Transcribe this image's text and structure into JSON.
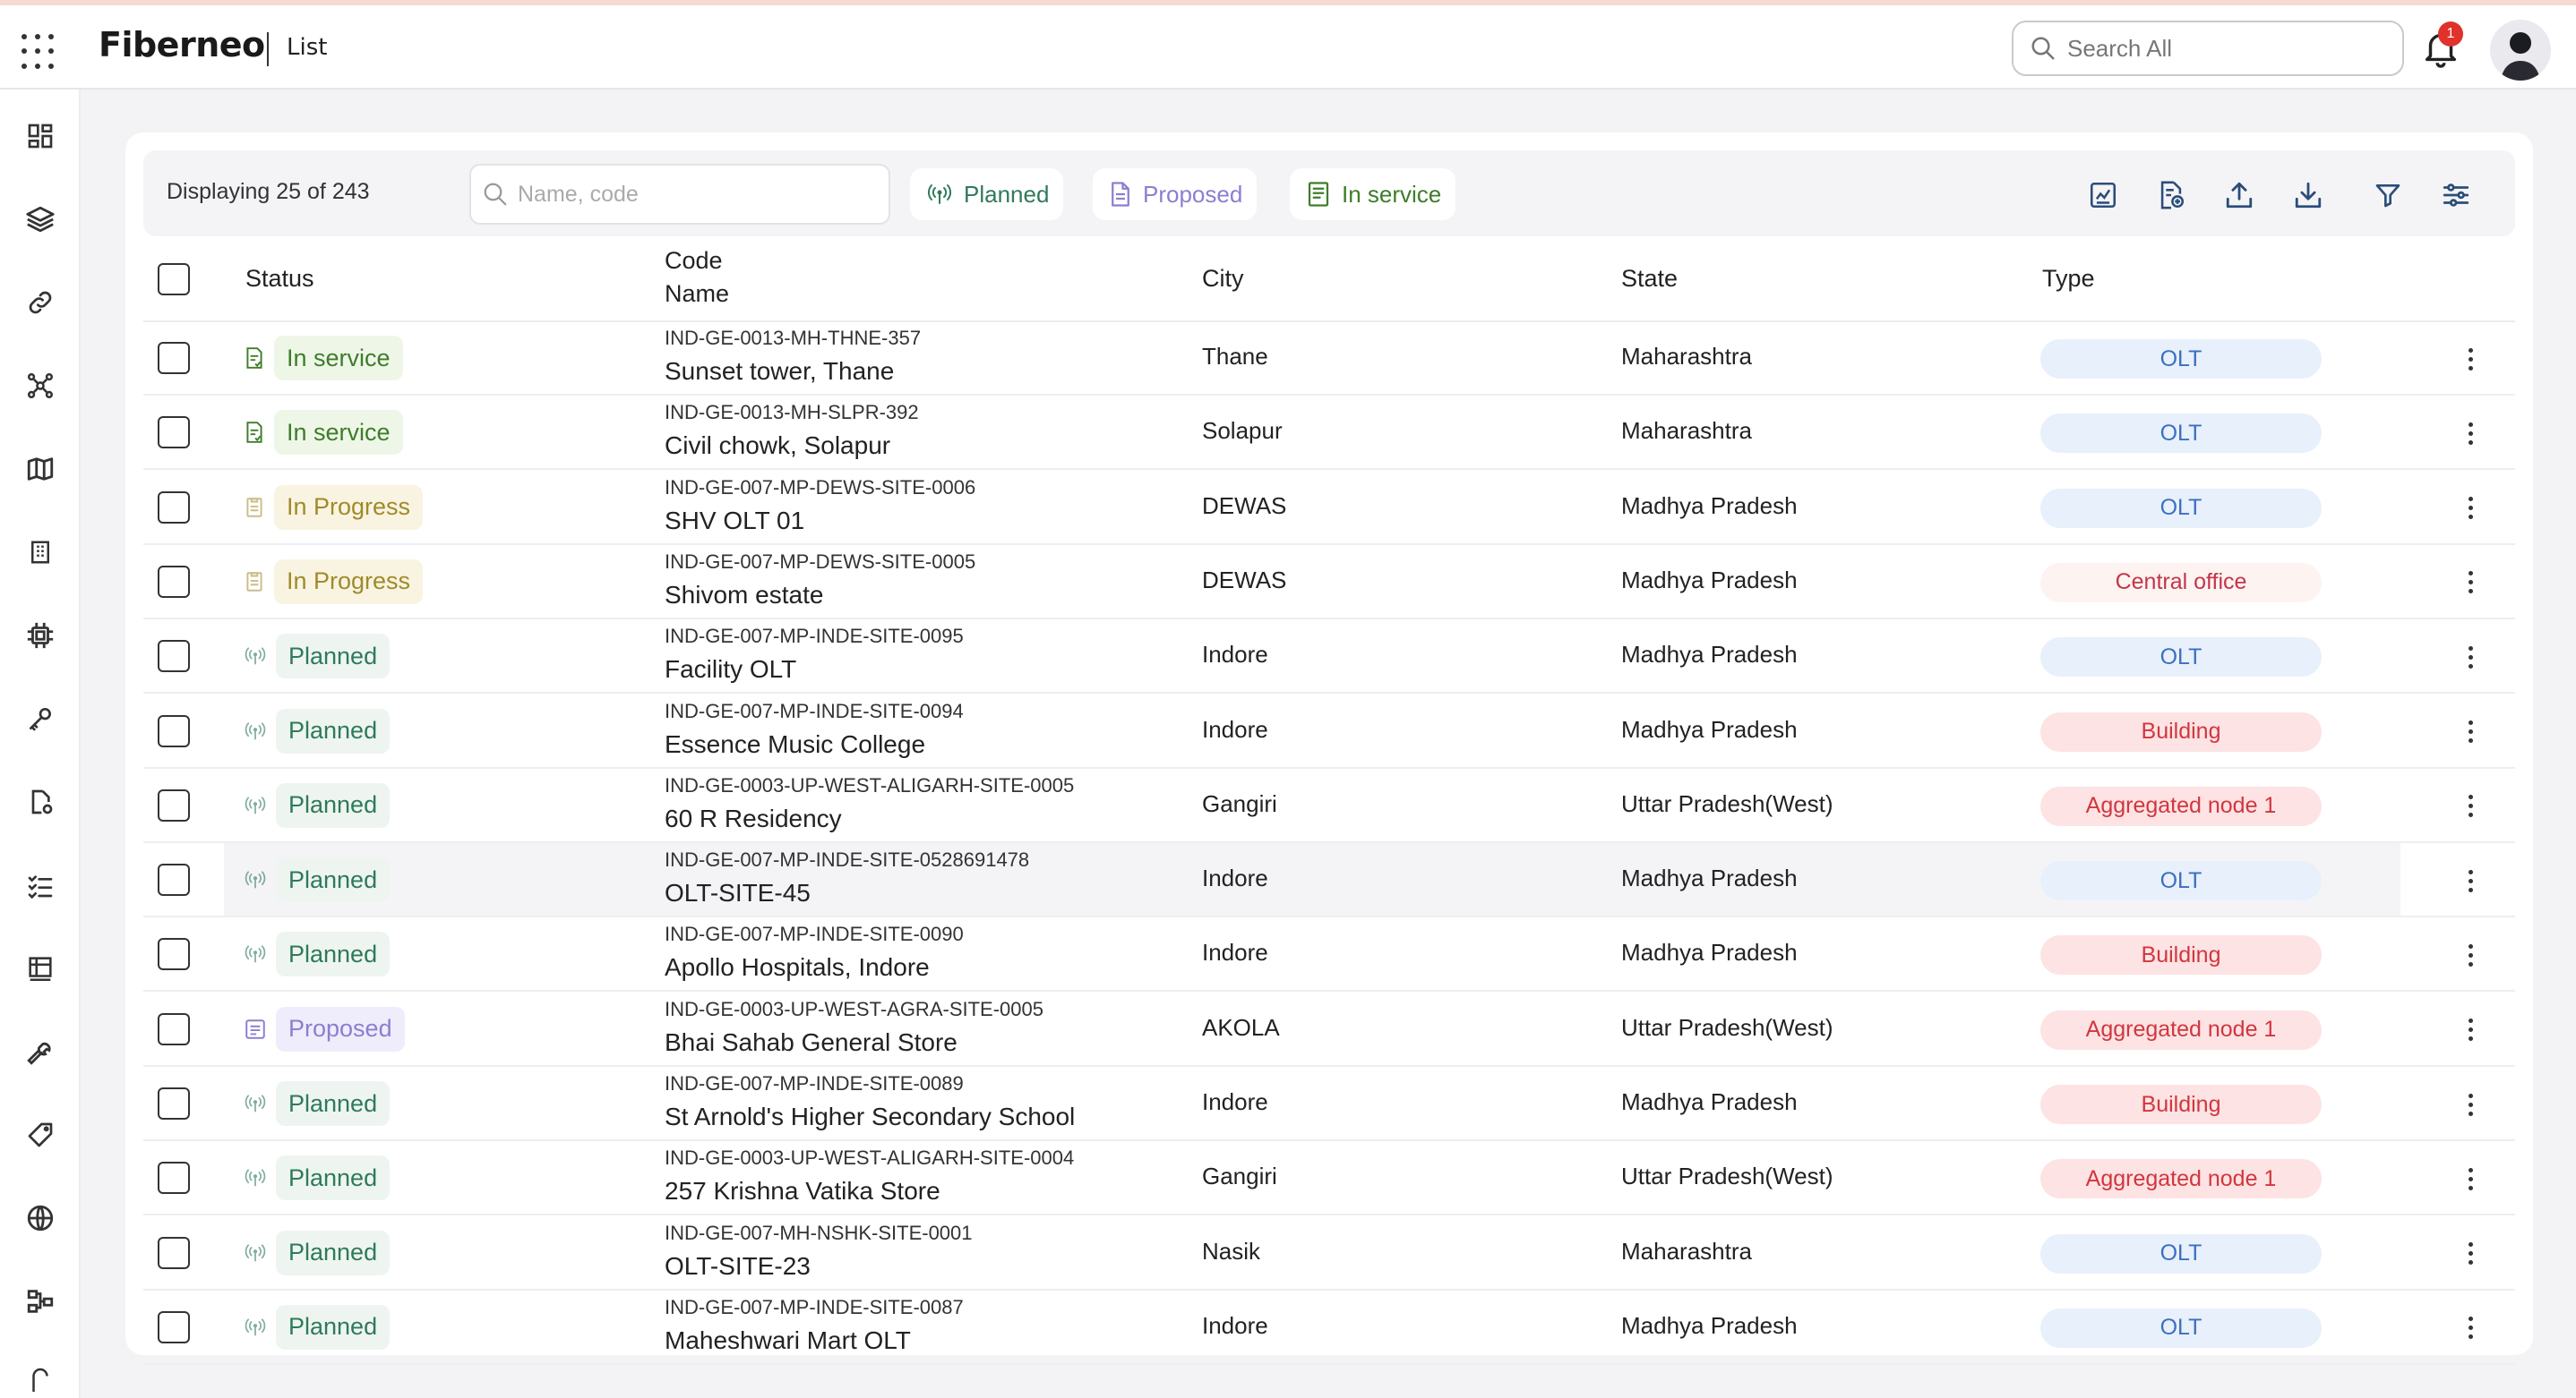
{
  "header": {
    "brand": "Fiberneo",
    "page_name": "List",
    "search_placeholder": "Search All",
    "notification_count": "1"
  },
  "sidebar": {
    "icons": [
      "dashboard-icon",
      "layers-icon",
      "link-icon",
      "network-icon",
      "map-icon",
      "building-icon",
      "chip-icon",
      "wrench-icon",
      "document-settings-icon",
      "checklist-icon",
      "inventory-icon",
      "tools-icon",
      "tag-icon",
      "globe-icon",
      "hierarchy-icon",
      "more-icon"
    ]
  },
  "toolbar": {
    "displaying": "Displaying 25 of 243",
    "search_placeholder": "Name, code",
    "chips": [
      {
        "label": "Planned",
        "color": "#2f7a5a",
        "icon": "antenna-icon"
      },
      {
        "label": "Proposed",
        "color": "#8a7fd0",
        "icon": "document-icon"
      },
      {
        "label": "In service",
        "color": "#3e7d2a",
        "icon": "list-document-icon"
      }
    ],
    "tools": [
      "report-icon",
      "add-report-icon",
      "upload-icon",
      "download-icon",
      "filter-icon",
      "settings-sliders-icon"
    ]
  },
  "table": {
    "headers": {
      "status": "Status",
      "code": "Code",
      "name": "Name",
      "city": "City",
      "state": "State",
      "type": "Type"
    },
    "rows": [
      {
        "status": "In service",
        "code": "IND-GE-0013-MH-THNE-357",
        "name": "Sunset tower, Thane",
        "city": "Thane",
        "state": "Maharashtra",
        "type": "OLT"
      },
      {
        "status": "In service",
        "code": "IND-GE-0013-MH-SLPR-392",
        "name": "Civil chowk, Solapur",
        "city": "Solapur",
        "state": "Maharashtra",
        "type": "OLT"
      },
      {
        "status": "In Progress",
        "code": "IND-GE-007-MP-DEWS-SITE-0006",
        "name": "SHV OLT 01",
        "city": "DEWAS",
        "state": "Madhya Pradesh",
        "type": "OLT"
      },
      {
        "status": "In Progress",
        "code": "IND-GE-007-MP-DEWS-SITE-0005",
        "name": "Shivom estate",
        "city": "DEWAS",
        "state": "Madhya Pradesh",
        "type": "Central office"
      },
      {
        "status": "Planned",
        "code": "IND-GE-007-MP-INDE-SITE-0095",
        "name": "Facility OLT",
        "city": "Indore",
        "state": "Madhya Pradesh",
        "type": "OLT"
      },
      {
        "status": "Planned",
        "code": "IND-GE-007-MP-INDE-SITE-0094",
        "name": "Essence Music College",
        "city": "Indore",
        "state": "Madhya Pradesh",
        "type": "Building"
      },
      {
        "status": "Planned",
        "code": "IND-GE-0003-UP-WEST-ALIGARH-SITE-0005",
        "name": "60 R Residency",
        "city": "Gangiri",
        "state": "Uttar Pradesh(West)",
        "type": "Aggregated node 1"
      },
      {
        "status": "Planned",
        "code": "IND-GE-007-MP-INDE-SITE-0528691478",
        "name": "OLT-SITE-45",
        "city": "Indore",
        "state": "Madhya Pradesh",
        "type": "OLT"
      },
      {
        "status": "Planned",
        "code": "IND-GE-007-MP-INDE-SITE-0090",
        "name": "Apollo Hospitals, Indore",
        "city": "Indore",
        "state": "Madhya Pradesh",
        "type": "Building"
      },
      {
        "status": "Proposed",
        "code": "IND-GE-0003-UP-WEST-AGRA-SITE-0005",
        "name": "Bhai Sahab General Store",
        "city": "AKOLA",
        "state": "Uttar Pradesh(West)",
        "type": "Aggregated node 1"
      },
      {
        "status": "Planned",
        "code": "IND-GE-007-MP-INDE-SITE-0089",
        "name": "St Arnold's Higher Secondary School",
        "city": "Indore",
        "state": "Madhya Pradesh",
        "type": "Building"
      },
      {
        "status": "Planned",
        "code": "IND-GE-0003-UP-WEST-ALIGARH-SITE-0004",
        "name": "257 Krishna Vatika Store",
        "city": "Gangiri",
        "state": "Uttar Pradesh(West)",
        "type": "Aggregated node 1"
      },
      {
        "status": "Planned",
        "code": "IND-GE-007-MH-NSHK-SITE-0001",
        "name": "OLT-SITE-23",
        "city": "Nasik",
        "state": "Maharashtra",
        "type": "OLT"
      },
      {
        "status": "Planned",
        "code": "IND-GE-007-MP-INDE-SITE-0087",
        "name": "Maheshwari Mart OLT",
        "city": "Indore",
        "state": "Madhya Pradesh",
        "type": "OLT"
      }
    ]
  },
  "styles": {
    "status": {
      "In service": {
        "fg": "#3e7d2a",
        "bg": "#eef6e8"
      },
      "In Progress": {
        "fg": "#a08a2a",
        "bg": "#f8f4e1"
      },
      "Planned": {
        "fg": "#2f7a5a",
        "bg": "#eef5f1"
      },
      "Proposed": {
        "fg": "#8a7fd0",
        "bg": "#efecfb"
      }
    },
    "type": {
      "OLT": {
        "fg": "#3a6fc2",
        "bg": "#e8f0fb"
      },
      "Central office": {
        "fg": "#c2364a",
        "bg": "#fdf3f1"
      },
      "Building": {
        "fg": "#d2363f",
        "bg": "#fde3e3"
      },
      "Aggregated node 1": {
        "fg": "#d2363f",
        "bg": "#fde3e3"
      }
    }
  }
}
